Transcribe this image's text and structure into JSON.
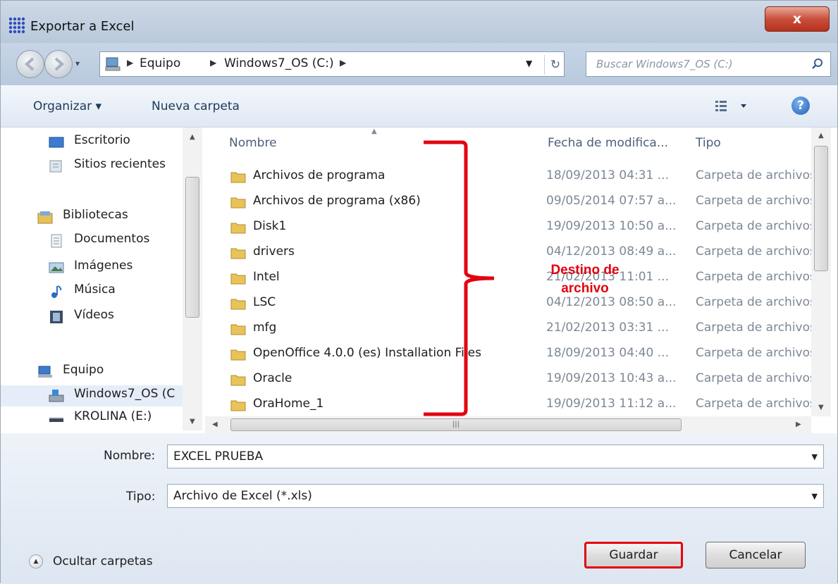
{
  "window": {
    "title": "Exportar a Excel",
    "close_label": "x"
  },
  "address": {
    "crumbs": [
      "Equipo",
      "Windows7_OS (C:)"
    ],
    "search_placeholder": "Buscar Windows7_OS (C:)"
  },
  "toolbar": {
    "organize_label": "Organizar ▾",
    "new_folder_label": "Nueva carpeta"
  },
  "sidebar": {
    "items": [
      {
        "label": "Escritorio",
        "icon": "desktop-icon"
      },
      {
        "label": "Sitios recientes",
        "icon": "recent-places-icon"
      },
      {
        "label": "Bibliotecas",
        "icon": "libraries-icon"
      },
      {
        "label": "Documentos",
        "icon": "documents-icon"
      },
      {
        "label": "Imágenes",
        "icon": "pictures-icon"
      },
      {
        "label": "Música",
        "icon": "music-icon"
      },
      {
        "label": "Vídeos",
        "icon": "videos-icon"
      },
      {
        "label": "Equipo",
        "icon": "computer-icon"
      },
      {
        "label": "Windows7_OS (C",
        "icon": "drive-c-icon"
      },
      {
        "label": "KROLINA (E:)",
        "icon": "removable-drive-icon"
      }
    ]
  },
  "filelist": {
    "columns": {
      "name": "Nombre",
      "date": "Fecha de modifica...",
      "type": "Tipo"
    },
    "rows": [
      {
        "name": "Archivos de programa",
        "date": "18/09/2013 04:31 ...",
        "type": "Carpeta de archivos"
      },
      {
        "name": "Archivos de programa (x86)",
        "date": "09/05/2014 07:57 a...",
        "type": "Carpeta de archivos"
      },
      {
        "name": "Disk1",
        "date": "19/09/2013 10:50 a...",
        "type": "Carpeta de archivos"
      },
      {
        "name": "drivers",
        "date": "04/12/2013 08:49 a...",
        "type": "Carpeta de archivos"
      },
      {
        "name": "Intel",
        "date": "21/02/2013 11:01 ...",
        "type": "Carpeta de archivos"
      },
      {
        "name": "LSC",
        "date": "04/12/2013 08:50 a...",
        "type": "Carpeta de archivos"
      },
      {
        "name": "mfg",
        "date": "21/02/2013 03:31 ...",
        "type": "Carpeta de archivos"
      },
      {
        "name": "OpenOffice 4.0.0 (es) Installation Files",
        "date": "18/09/2013 04:40 ...",
        "type": "Carpeta de archivos"
      },
      {
        "name": "Oracle",
        "date": "19/09/2013 10:43 a...",
        "type": "Carpeta de archivos"
      },
      {
        "name": "OraHome_1",
        "date": "19/09/2013 11:12 a...",
        "type": "Carpeta de archivos"
      }
    ]
  },
  "annotation": {
    "line1": "Destino de",
    "line2": "archivo",
    "color": "#e3000f"
  },
  "form": {
    "name_label": "Nombre:",
    "name_value": "EXCEL PRUEBA",
    "type_label": "Tipo:",
    "type_value": "Archivo de Excel (*.xls)"
  },
  "footer": {
    "hide_folders_label": "Ocultar carpetas",
    "save_label": "Guardar",
    "cancel_label": "Cancelar"
  }
}
